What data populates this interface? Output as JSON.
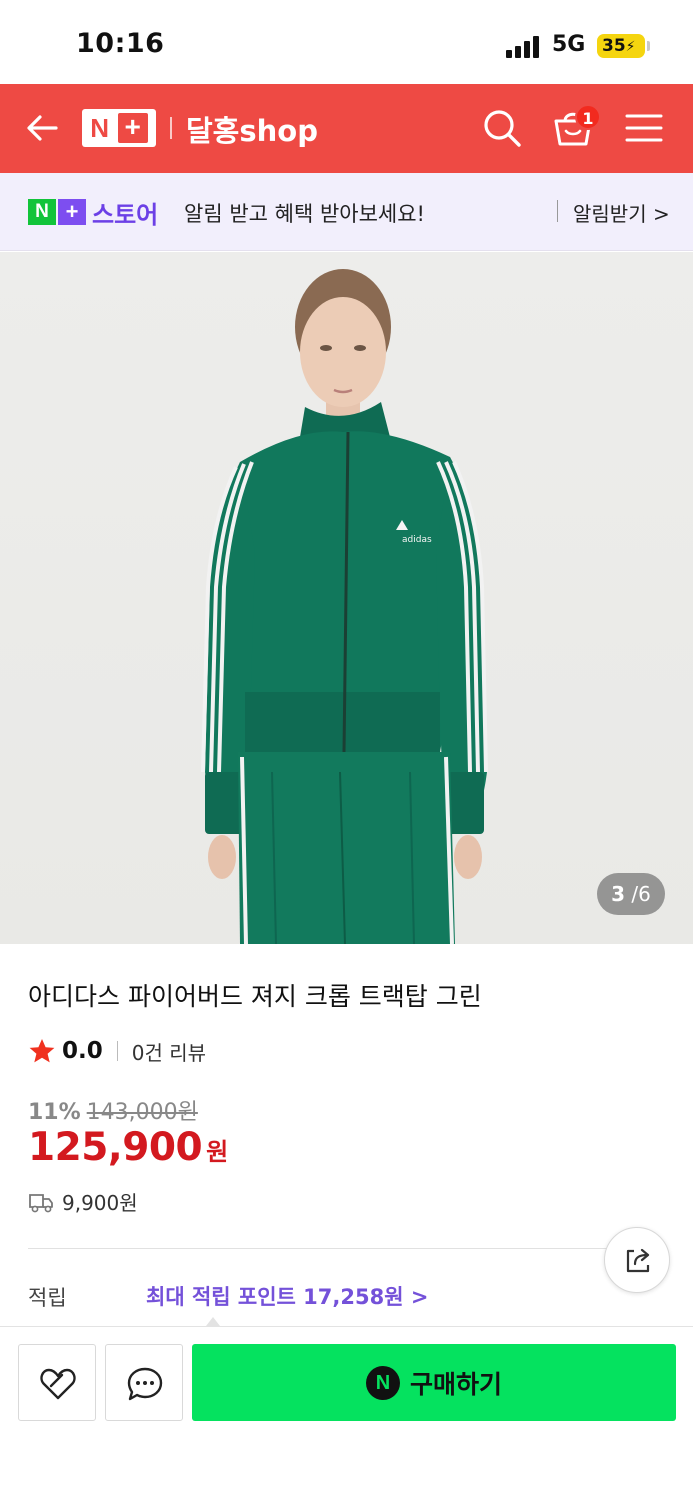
{
  "status_bar": {
    "time": "10:16",
    "network": "5G",
    "battery": "35"
  },
  "header": {
    "logo_n": "N",
    "logo_plus": "+",
    "shop_name": "달홍shop",
    "cart_count": "1",
    "accent_color": "#ee4a44"
  },
  "notice": {
    "store_logo_n": "N",
    "store_logo_plus": "+",
    "store_logo_text": "스토어",
    "message": "알림 받고 혜택 받아보세요!",
    "button_label": "알림받기 >"
  },
  "gallery": {
    "current": "3",
    "separator": "/",
    "total": "6"
  },
  "product": {
    "title": "아디다스 파이어버드 져지 크롭 트랙탑 그린",
    "rating": "0.0",
    "review_count": "0건 리뷰",
    "discount_rate": "11%",
    "original_price": "143,000원",
    "sale_price": "125,900",
    "price_unit": "원",
    "shipping_fee": "9,900원",
    "points_label": "적립",
    "points_link": "최대 적립 포인트 17,258원 >"
  },
  "icons": {
    "back": "back-arrow-icon",
    "search": "search-icon",
    "cart": "cart-icon",
    "menu": "menu-icon",
    "star": "star-icon",
    "truck": "truck-icon",
    "share": "share-icon",
    "wish": "heart-icon",
    "chat": "chat-icon"
  },
  "bottom_bar": {
    "buy_n": "N",
    "buy_label": "구매하기",
    "buy_color": "#05e25f"
  }
}
